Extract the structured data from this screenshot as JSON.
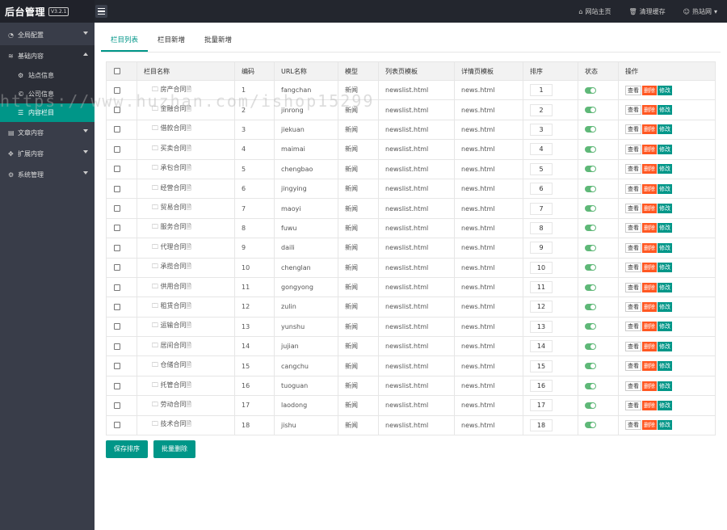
{
  "header": {
    "title": "后台管理",
    "version": "V3.2.1",
    "links": [
      {
        "icon": "home-icon",
        "label": "网站主页"
      },
      {
        "icon": "trash-icon",
        "label": "清理缓存"
      },
      {
        "icon": "user-icon",
        "label": "热站网"
      }
    ]
  },
  "sidebar": {
    "items": [
      {
        "label": "全局配置",
        "icon": "gauge-icon"
      },
      {
        "label": "基础内容",
        "icon": "layers-icon"
      },
      {
        "label": "文章内容",
        "icon": "document-icon"
      },
      {
        "label": "扩展内容",
        "icon": "expand-icon"
      },
      {
        "label": "系统管理",
        "icon": "gear-icon"
      }
    ],
    "sub_items": [
      {
        "label": "站点信息",
        "icon": "gear-icon"
      },
      {
        "label": "公司信息",
        "icon": "copyright-icon"
      },
      {
        "label": "内容栏目",
        "icon": "list-icon"
      }
    ]
  },
  "tabs": [
    "栏目列表",
    "栏目新增",
    "批量新增"
  ],
  "table": {
    "headers": [
      "栏目名称",
      "编码",
      "URL名称",
      "模型",
      "列表页模板",
      "详情页模板",
      "排序",
      "状态",
      "操作"
    ],
    "rows": [
      {
        "name": "房产合同",
        "code": "1",
        "url": "fangchan",
        "model": "新闻",
        "list": "newslist.html",
        "detail": "news.html",
        "sort": "1"
      },
      {
        "name": "金融合同",
        "code": "2",
        "url": "jinrong",
        "model": "新闻",
        "list": "newslist.html",
        "detail": "news.html",
        "sort": "2"
      },
      {
        "name": "借款合同",
        "code": "3",
        "url": "jiekuan",
        "model": "新闻",
        "list": "newslist.html",
        "detail": "news.html",
        "sort": "3"
      },
      {
        "name": "买卖合同",
        "code": "4",
        "url": "maimai",
        "model": "新闻",
        "list": "newslist.html",
        "detail": "news.html",
        "sort": "4"
      },
      {
        "name": "承包合同",
        "code": "5",
        "url": "chengbao",
        "model": "新闻",
        "list": "newslist.html",
        "detail": "news.html",
        "sort": "5"
      },
      {
        "name": "经营合同",
        "code": "6",
        "url": "jingying",
        "model": "新闻",
        "list": "newslist.html",
        "detail": "news.html",
        "sort": "6"
      },
      {
        "name": "贸易合同",
        "code": "7",
        "url": "maoyi",
        "model": "新闻",
        "list": "newslist.html",
        "detail": "news.html",
        "sort": "7"
      },
      {
        "name": "服务合同",
        "code": "8",
        "url": "fuwu",
        "model": "新闻",
        "list": "newslist.html",
        "detail": "news.html",
        "sort": "8"
      },
      {
        "name": "代理合同",
        "code": "9",
        "url": "daili",
        "model": "新闻",
        "list": "newslist.html",
        "detail": "news.html",
        "sort": "9"
      },
      {
        "name": "承揽合同",
        "code": "10",
        "url": "chenglan",
        "model": "新闻",
        "list": "newslist.html",
        "detail": "news.html",
        "sort": "10"
      },
      {
        "name": "供用合同",
        "code": "11",
        "url": "gongyong",
        "model": "新闻",
        "list": "newslist.html",
        "detail": "news.html",
        "sort": "11"
      },
      {
        "name": "租赁合同",
        "code": "12",
        "url": "zulin",
        "model": "新闻",
        "list": "newslist.html",
        "detail": "news.html",
        "sort": "12"
      },
      {
        "name": "运输合同",
        "code": "13",
        "url": "yunshu",
        "model": "新闻",
        "list": "newslist.html",
        "detail": "news.html",
        "sort": "13"
      },
      {
        "name": "居间合同",
        "code": "14",
        "url": "jujian",
        "model": "新闻",
        "list": "newslist.html",
        "detail": "news.html",
        "sort": "14"
      },
      {
        "name": "仓储合同",
        "code": "15",
        "url": "cangchu",
        "model": "新闻",
        "list": "newslist.html",
        "detail": "news.html",
        "sort": "15"
      },
      {
        "name": "托管合同",
        "code": "16",
        "url": "tuoguan",
        "model": "新闻",
        "list": "newslist.html",
        "detail": "news.html",
        "sort": "16"
      },
      {
        "name": "劳动合同",
        "code": "17",
        "url": "laodong",
        "model": "新闻",
        "list": "newslist.html",
        "detail": "news.html",
        "sort": "17"
      },
      {
        "name": "技术合同",
        "code": "18",
        "url": "jishu",
        "model": "新闻",
        "list": "newslist.html",
        "detail": "news.html",
        "sort": "18"
      }
    ],
    "actions": {
      "view": "查看",
      "delete": "删除",
      "edit": "修改"
    }
  },
  "buttons": {
    "save_sort": "保存排序",
    "batch_delete": "批量删除"
  },
  "watermark": "https://www.huzhan.com/ishop15299",
  "colors": {
    "accent": "#009688",
    "danger": "#ff5722",
    "switch_on": "#5fb878",
    "sidebar": "#393d49",
    "topbar": "#23262e"
  }
}
